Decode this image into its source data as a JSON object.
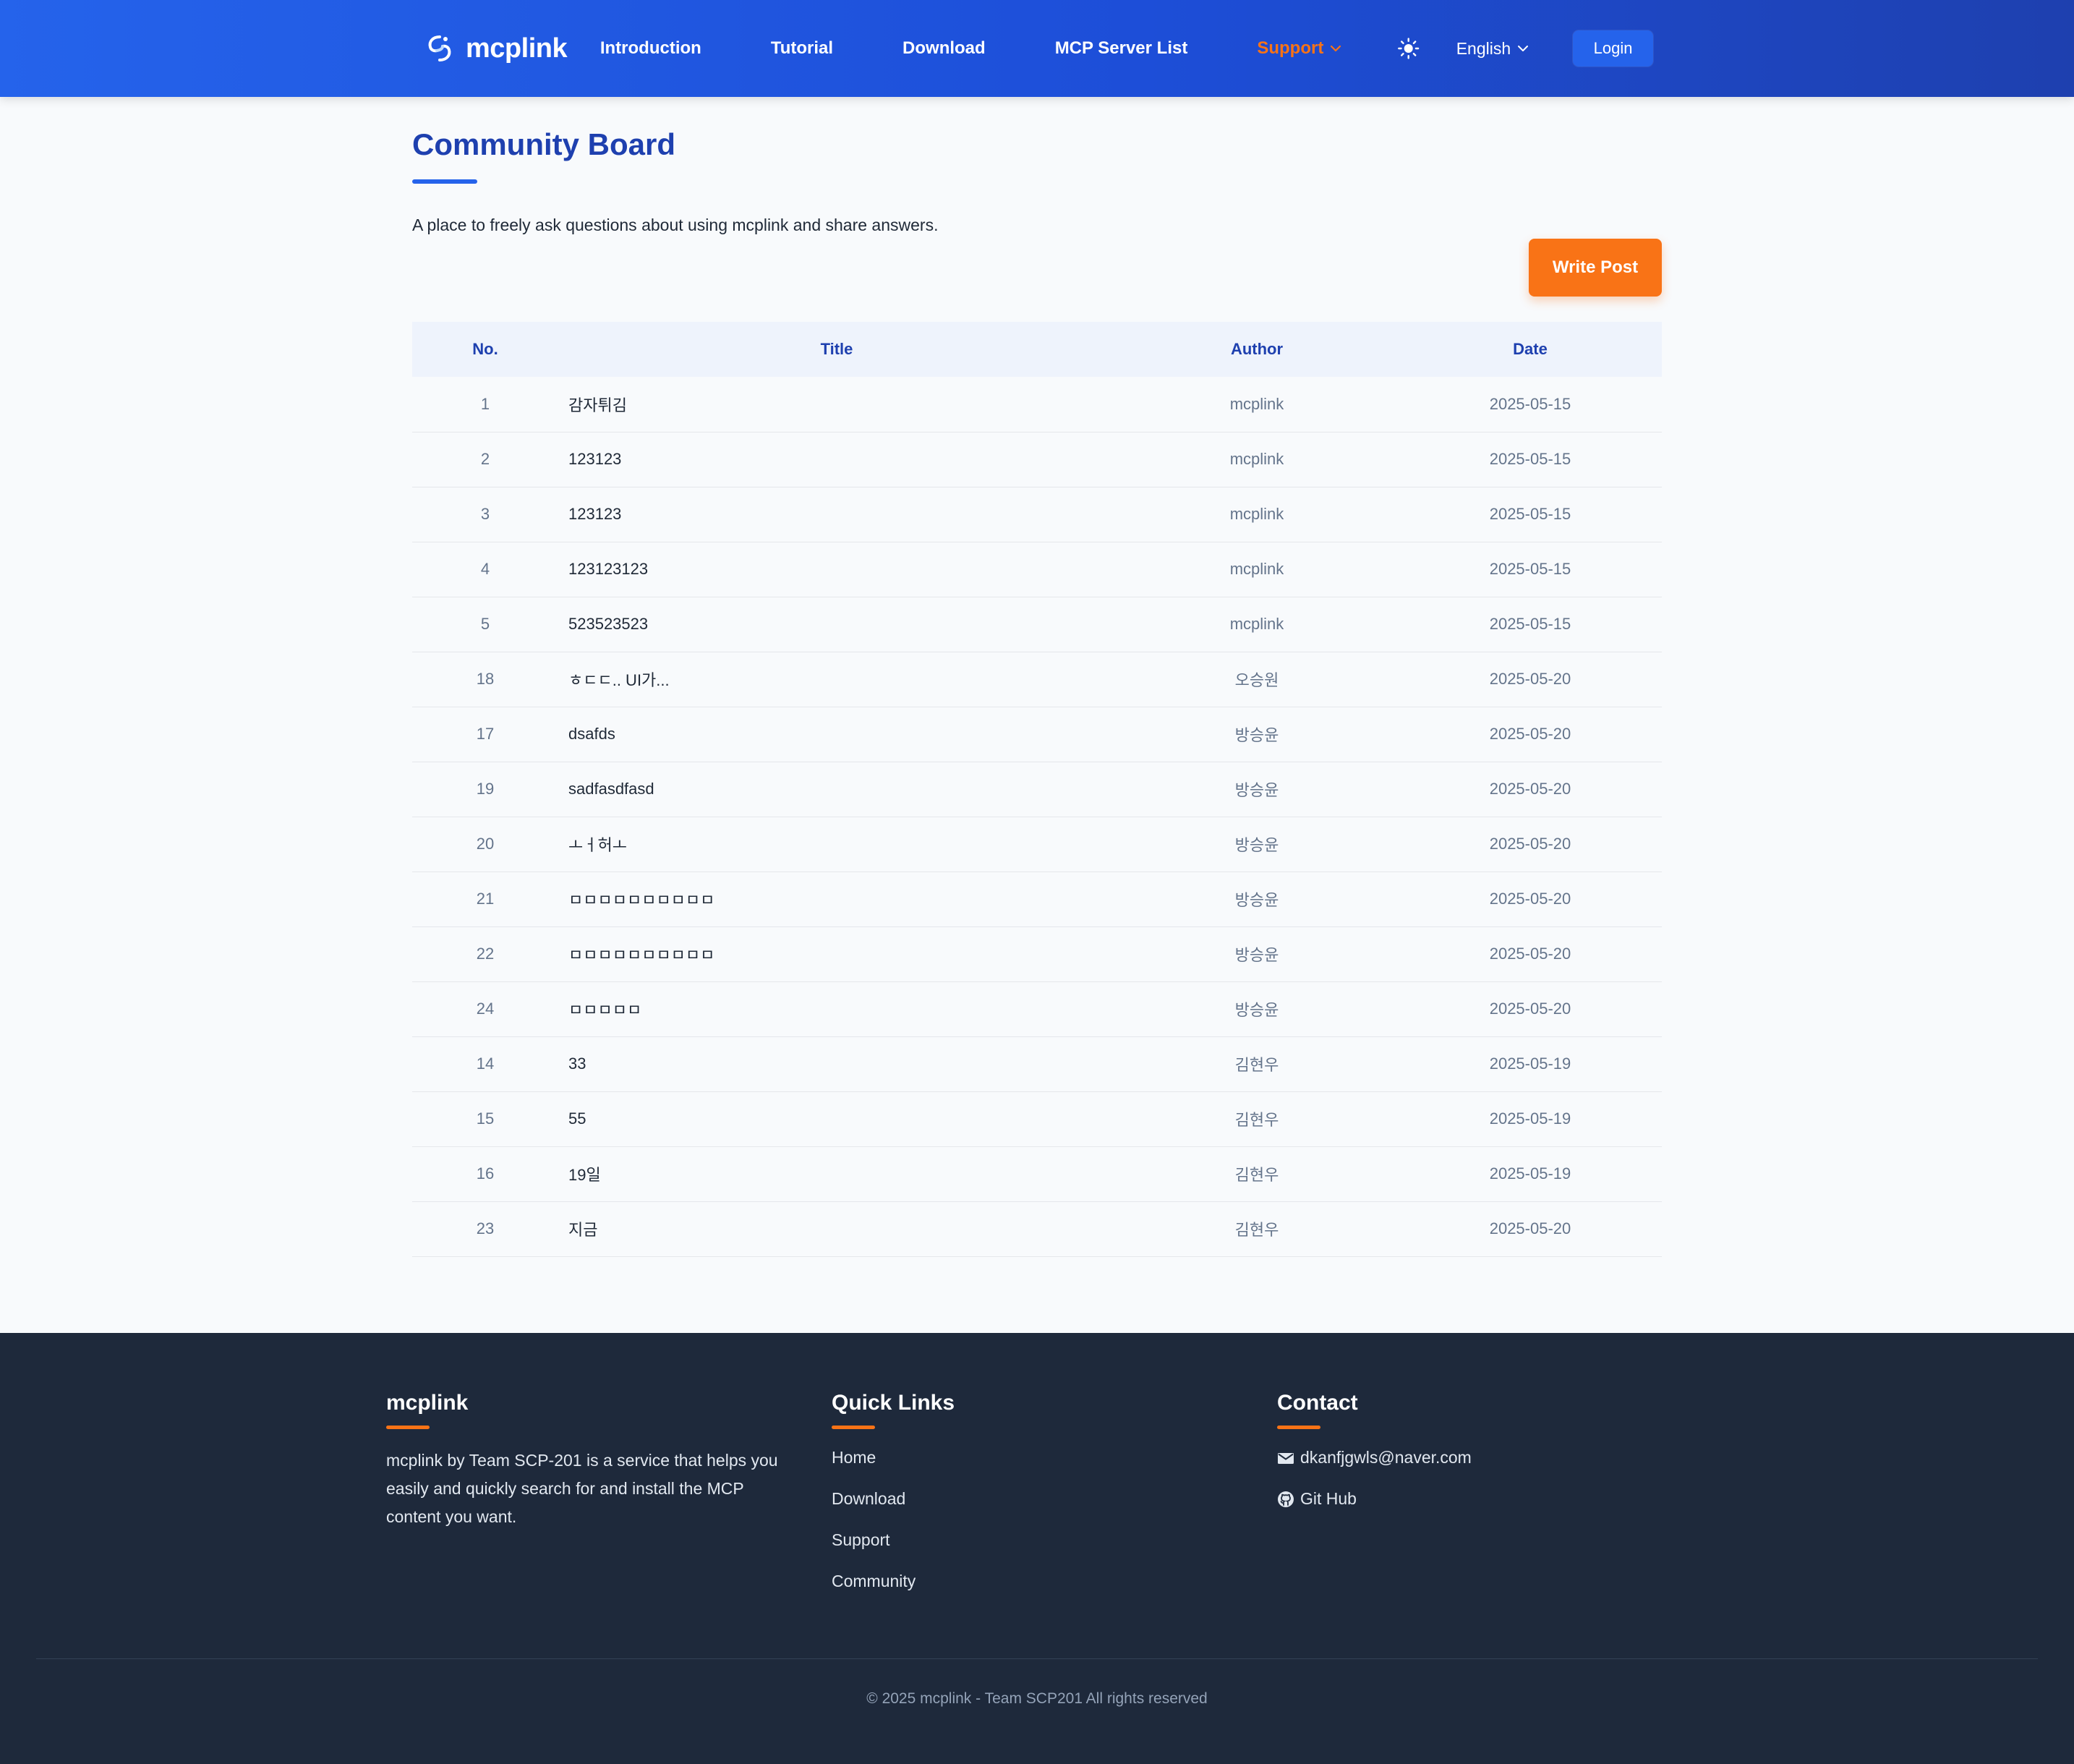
{
  "nav": {
    "brand": "mcplink",
    "links": [
      "Introduction",
      "Tutorial",
      "Download",
      "MCP Server List"
    ],
    "support": "Support",
    "language": "English",
    "login": "Login"
  },
  "page": {
    "title": "Community Board",
    "description": "A place to freely ask questions about using mcplink and share answers.",
    "write_button": "Write Post"
  },
  "table": {
    "headers": {
      "no": "No.",
      "title": "Title",
      "author": "Author",
      "date": "Date"
    },
    "rows": [
      {
        "no": "1",
        "title": "감자튀김",
        "author": "mcplink",
        "date": "2025-05-15"
      },
      {
        "no": "2",
        "title": "123123",
        "author": "mcplink",
        "date": "2025-05-15"
      },
      {
        "no": "3",
        "title": "123123",
        "author": "mcplink",
        "date": "2025-05-15"
      },
      {
        "no": "4",
        "title": "123123123",
        "author": "mcplink",
        "date": "2025-05-15"
      },
      {
        "no": "5",
        "title": "523523523",
        "author": "mcplink",
        "date": "2025-05-15"
      },
      {
        "no": "18",
        "title": "ㅎㄷㄷ.. UI가...",
        "author": "오승원",
        "date": "2025-05-20"
      },
      {
        "no": "17",
        "title": "dsafds",
        "author": "방승윤",
        "date": "2025-05-20"
      },
      {
        "no": "19",
        "title": "sadfasdfasd",
        "author": "방승윤",
        "date": "2025-05-20"
      },
      {
        "no": "20",
        "title": "ㅗㅓ허ㅗ",
        "author": "방승윤",
        "date": "2025-05-20"
      },
      {
        "no": "21",
        "title": "ㅁㅁㅁㅁㅁㅁㅁㅁㅁㅁ",
        "author": "방승윤",
        "date": "2025-05-20"
      },
      {
        "no": "22",
        "title": "ㅁㅁㅁㅁㅁㅁㅁㅁㅁㅁ",
        "author": "방승윤",
        "date": "2025-05-20"
      },
      {
        "no": "24",
        "title": "ㅁㅁㅁㅁㅁ",
        "author": "방승윤",
        "date": "2025-05-20"
      },
      {
        "no": "14",
        "title": "33",
        "author": "김현우",
        "date": "2025-05-19"
      },
      {
        "no": "15",
        "title": "55",
        "author": "김현우",
        "date": "2025-05-19"
      },
      {
        "no": "16",
        "title": "19일",
        "author": "김현우",
        "date": "2025-05-19"
      },
      {
        "no": "23",
        "title": "지금",
        "author": "김현우",
        "date": "2025-05-20"
      }
    ]
  },
  "footer": {
    "about": {
      "title": "mcplink",
      "text": "mcplink by Team SCP-201 is a service that helps you easily and quickly search for and install the MCP content you want."
    },
    "quick_links": {
      "title": "Quick Links",
      "items": [
        "Home",
        "Download",
        "Support",
        "Community"
      ]
    },
    "contact": {
      "title": "Contact",
      "email": "dkanfjgwls@naver.com",
      "github": "Git Hub"
    },
    "copyright": "© 2025 mcplink - Team SCP201 All rights reserved"
  },
  "colors": {
    "nav_gradient_start": "#2563eb",
    "nav_gradient_end": "#1e40af",
    "accent_orange": "#f97316",
    "title_blue": "#1e40af",
    "footer_bg": "#1e293b"
  },
  "icons": {
    "brand": "mcplink-logo-icon",
    "theme": "sun-icon",
    "chevron": "chevron-down-icon",
    "email": "envelope-icon",
    "github": "github-icon"
  }
}
